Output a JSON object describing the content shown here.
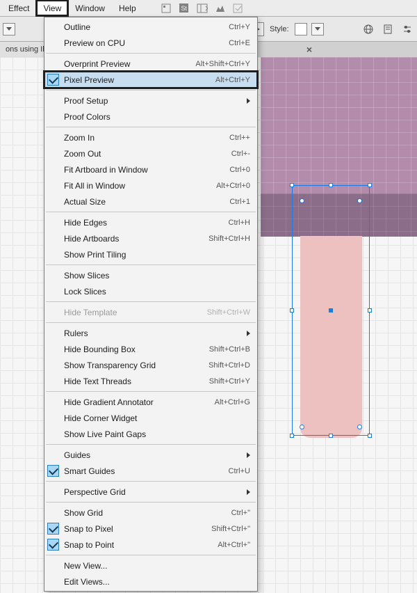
{
  "menubar": {
    "items": [
      "Effect",
      "View",
      "Window",
      "Help"
    ],
    "active_index": 1
  },
  "optionsbar": {
    "style_label": "Style:"
  },
  "doc_tab": {
    "title": "ons using Illu",
    "close": "×"
  },
  "view_menu": {
    "sections": [
      [
        {
          "label": "Outline",
          "shortcut": "Ctrl+Y"
        },
        {
          "label": "Preview on CPU",
          "shortcut": "Ctrl+E"
        }
      ],
      [
        {
          "label": "Overprint Preview",
          "shortcut": "Alt+Shift+Ctrl+Y"
        },
        {
          "label": "Pixel Preview",
          "shortcut": "Alt+Ctrl+Y",
          "checked": true,
          "highlight": true
        }
      ],
      [
        {
          "label": "Proof Setup",
          "submenu": true
        },
        {
          "label": "Proof Colors"
        }
      ],
      [
        {
          "label": "Zoom In",
          "shortcut": "Ctrl++"
        },
        {
          "label": "Zoom Out",
          "shortcut": "Ctrl+-"
        },
        {
          "label": "Fit Artboard in Window",
          "shortcut": "Ctrl+0"
        },
        {
          "label": "Fit All in Window",
          "shortcut": "Alt+Ctrl+0"
        },
        {
          "label": "Actual Size",
          "shortcut": "Ctrl+1"
        }
      ],
      [
        {
          "label": "Hide Edges",
          "shortcut": "Ctrl+H"
        },
        {
          "label": "Hide Artboards",
          "shortcut": "Shift+Ctrl+H"
        },
        {
          "label": "Show Print Tiling"
        }
      ],
      [
        {
          "label": "Show Slices"
        },
        {
          "label": "Lock Slices"
        }
      ],
      [
        {
          "label": "Hide Template",
          "shortcut": "Shift+Ctrl+W",
          "disabled": true
        }
      ],
      [
        {
          "label": "Rulers",
          "submenu": true
        },
        {
          "label": "Hide Bounding Box",
          "shortcut": "Shift+Ctrl+B"
        },
        {
          "label": "Show Transparency Grid",
          "shortcut": "Shift+Ctrl+D"
        },
        {
          "label": "Hide Text Threads",
          "shortcut": "Shift+Ctrl+Y"
        }
      ],
      [
        {
          "label": "Hide Gradient Annotator",
          "shortcut": "Alt+Ctrl+G"
        },
        {
          "label": "Hide Corner Widget"
        },
        {
          "label": "Show Live Paint Gaps"
        }
      ],
      [
        {
          "label": "Guides",
          "submenu": true
        },
        {
          "label": "Smart Guides",
          "shortcut": "Ctrl+U",
          "checked": true
        }
      ],
      [
        {
          "label": "Perspective Grid",
          "submenu": true
        }
      ],
      [
        {
          "label": "Show Grid",
          "shortcut": "Ctrl+\""
        },
        {
          "label": "Snap to Pixel",
          "shortcut": "Shift+Ctrl+\"",
          "checked": true
        },
        {
          "label": "Snap to Point",
          "shortcut": "Alt+Ctrl+\"",
          "checked": true
        }
      ],
      [
        {
          "label": "New View..."
        },
        {
          "label": "Edit Views..."
        }
      ]
    ]
  }
}
